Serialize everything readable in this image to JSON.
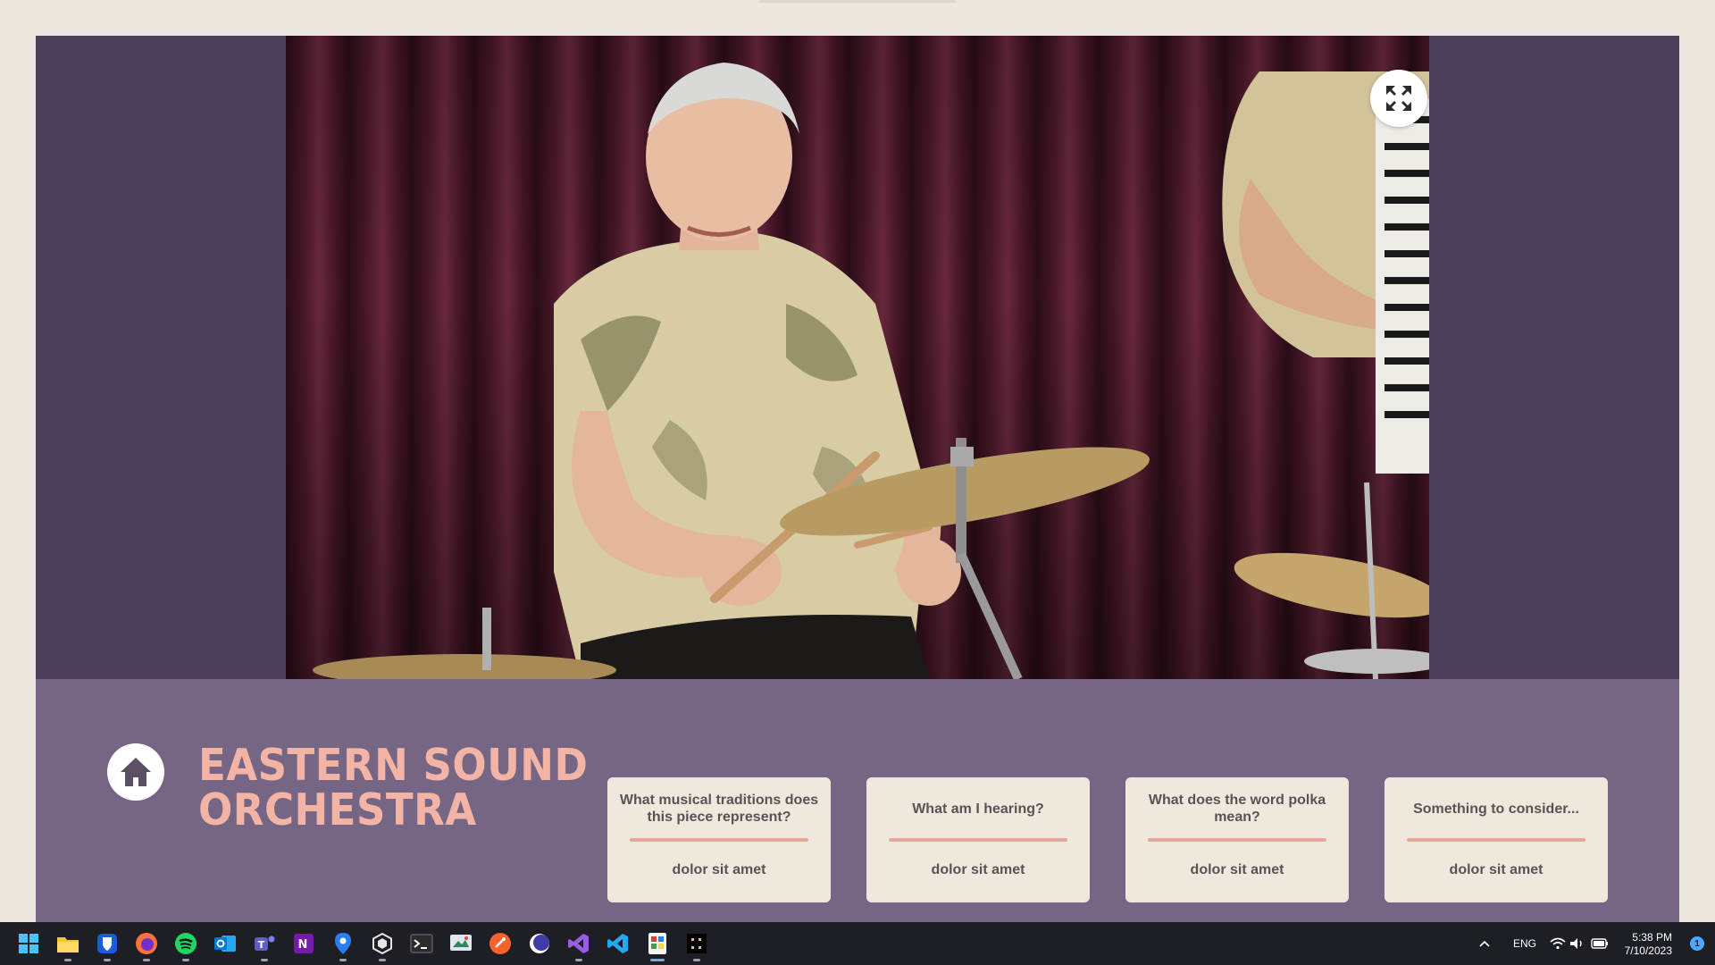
{
  "app": {
    "title_lines": [
      "EASTERN SOUND",
      "ORCHESTRA"
    ],
    "home_icon": "home-icon",
    "expand_icon": "expand-arrows-icon",
    "colors": {
      "frame": "#4a3e58",
      "panel": "#766685",
      "title": "#f3b4a6",
      "card": "#efe9dd",
      "rule": "#e6a79b"
    }
  },
  "cards": [
    {
      "question": "What musical traditions does this piece represent?",
      "answer": "dolor sit amet"
    },
    {
      "question": "What am I hearing?",
      "answer": "dolor sit amet"
    },
    {
      "question": "What does the word polka mean?",
      "answer": "dolor sit amet"
    },
    {
      "question": "Something to consider...",
      "answer": "dolor sit amet"
    }
  ],
  "taskbar": {
    "icons": [
      "windows-start-icon",
      "file-explorer-icon",
      "bitwarden-icon",
      "firefox-icon",
      "spotify-icon",
      "outlook-icon",
      "teams-icon",
      "onenote-icon",
      "maps-icon",
      "unity-icon",
      "terminal-icon",
      "snipping-tool-icon",
      "brave-icon",
      "eclipse-icon",
      "visual-studio-icon",
      "vscode-icon",
      "paint-icon",
      "notepad-icon"
    ],
    "tray": {
      "language": "ENG",
      "time": "5:38 PM",
      "date": "7/10/2023",
      "notifications": "1"
    }
  }
}
